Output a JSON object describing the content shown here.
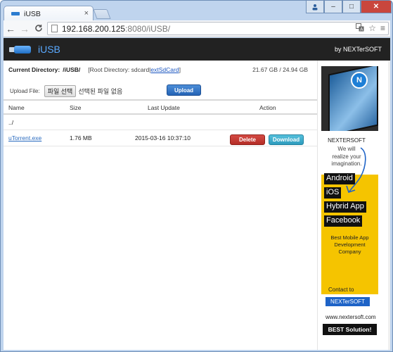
{
  "browser": {
    "tab_title": "iUSB",
    "tab_close": "×",
    "url_host": "192.168.200.125",
    "url_rest": ":8080/iUSB/",
    "nav_back": "←",
    "nav_forward": "→",
    "nav_reload": "C",
    "omni_icons": [
      "translate-icon",
      "star-icon",
      "menu-icon"
    ],
    "win_minimize": "–",
    "win_maximize": "□",
    "win_close": "✕"
  },
  "header": {
    "brand": "iUSB",
    "byline": "by NEXTerSOFT"
  },
  "directory": {
    "current_label": "Current Directory:",
    "current_value": "/iUSB/",
    "root_prefix": "[Root Directory:  sdcard",
    "root_separator": "|",
    "root_link": "extSdCard",
    "root_suffix": "]",
    "storage": "21.67 GB / 24.94 GB"
  },
  "upload": {
    "label": "Upload File:",
    "choose_button": "파일 선택",
    "no_file": "선택된 파일 없음",
    "upload_button": "Upload"
  },
  "table": {
    "columns": [
      "Name",
      "Size",
      "Last Update",
      "Action"
    ],
    "parent_row": "../",
    "rows": [
      {
        "name": "uTorrent.exe",
        "size": "1.76 MB",
        "updated": "2015-03-16 10:37:10",
        "delete_label": "Delete",
        "download_label": "Download"
      }
    ]
  },
  "ad": {
    "badge": "N",
    "brand": "NEXTERSOFT",
    "tagline": [
      "We will",
      "realize your",
      "imagination."
    ],
    "chips": [
      "Android",
      "iOS",
      "Hybrid App",
      "Facebook"
    ],
    "best": [
      "Best Mobile App",
      "Development",
      "Company"
    ],
    "contact": "Contact to",
    "name_button": "NEXTerSOFT",
    "site": "www.nextersoft.com",
    "solution": "BEST Solution!"
  },
  "colors": {
    "header_bg": "#222222",
    "brand_blue": "#5aa9ff",
    "delete_red": "#c0392b",
    "download_cyan": "#3aaccc",
    "upload_blue": "#2f6fc0",
    "ad_yellow": "#f5c400"
  }
}
